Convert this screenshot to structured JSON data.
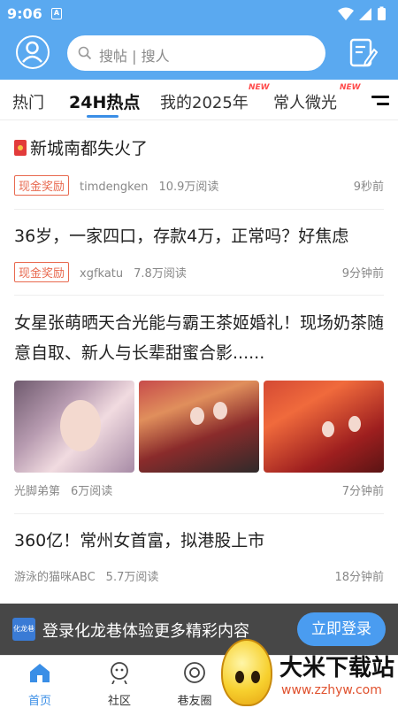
{
  "status_bar": {
    "time": "9:06",
    "notification_badge": "A"
  },
  "header": {
    "search_placeholder": "搜帖 | 搜人"
  },
  "tabs": [
    {
      "label": "热门"
    },
    {
      "label": "24H热点",
      "active": true
    },
    {
      "label": "我的2025年",
      "badge": "NEW"
    },
    {
      "label": "常人微光",
      "badge": "NEW"
    }
  ],
  "posts": [
    {
      "title": "新城南都失火了",
      "reward": "现金奖励",
      "author": "timdengken",
      "reads": "10.9万阅读",
      "time": "9秒前"
    },
    {
      "title": "36岁，一家四口，存款4万，正常吗？好焦虑",
      "reward": "现金奖励",
      "author": "xgfkatu",
      "reads": "7.8万阅读",
      "time": "9分钟前"
    },
    {
      "title": "女星张萌晒天合光能与霸王茶姬婚礼！现场奶茶随意自取、新人与长辈甜蜜合影......",
      "author": "光脚弟第",
      "reads": "6万阅读",
      "time": "7分钟前"
    },
    {
      "title": "360亿！常州女首富，拟港股上市",
      "author": "游泳的猫咪ABC",
      "reads": "5.7万阅读",
      "time": "18分钟前"
    }
  ],
  "banner": {
    "logo_text": "化龙巷",
    "text": "登录化龙巷体验更多精彩内容",
    "login_label": "立即登录"
  },
  "bottom_nav": [
    {
      "label": "首页",
      "active": true
    },
    {
      "label": "社区"
    },
    {
      "label": "巷友圈"
    }
  ],
  "watermark": {
    "title": "大米下载站",
    "url": "www.zzhyw.com"
  },
  "colors": {
    "header_blue": "#5aa9f0",
    "accent": "#3a8ee6",
    "reward_red": "#e8694f",
    "new_badge": "#ff4b4b"
  }
}
